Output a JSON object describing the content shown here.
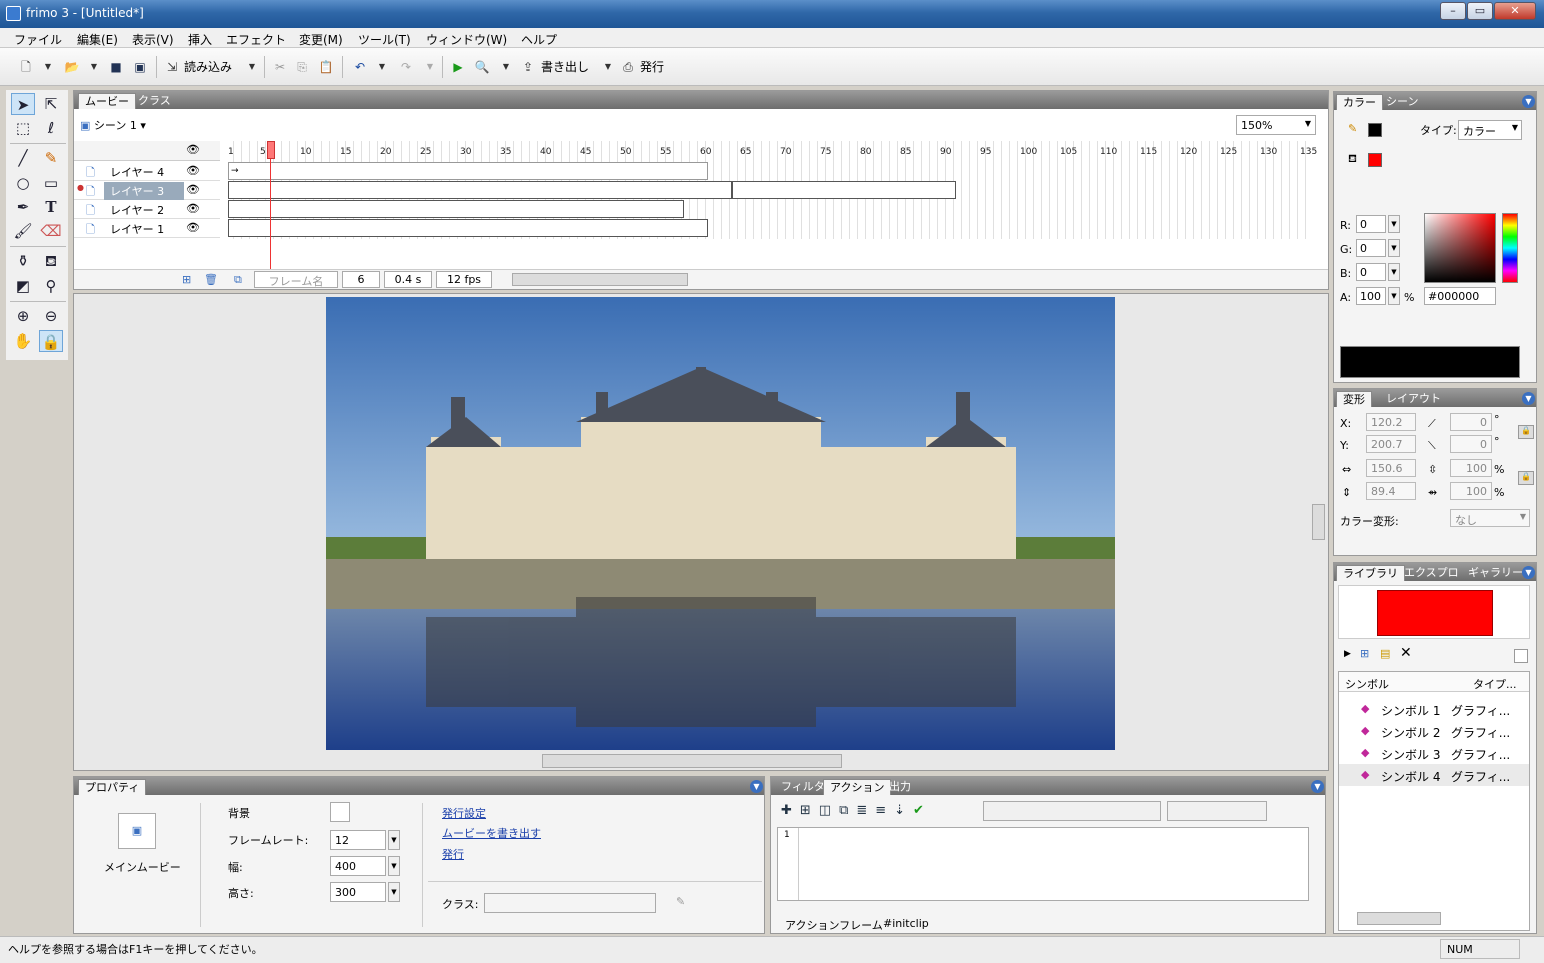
{
  "window": {
    "title": "frimo 3 - [Untitled*]"
  },
  "menu": [
    "ファイル",
    "編集(E)",
    "表示(V)",
    "挿入",
    "エフェクト",
    "変更(M)",
    "ツール(T)",
    "ウィンドウ(W)",
    "ヘルプ"
  ],
  "toolbar": {
    "import_label": "読み込み",
    "export_label": "書き出し",
    "publish_label": "発行"
  },
  "timeline": {
    "tabs": [
      "ムービー",
      "クラス"
    ],
    "scene_label": "シーン 1",
    "zoom": "150%",
    "ruler": [
      "1",
      "5",
      "10",
      "15",
      "20",
      "25",
      "30",
      "35",
      "40",
      "45",
      "50",
      "55",
      "60",
      "65",
      "70",
      "75",
      "80",
      "85",
      "90",
      "95",
      "100",
      "105",
      "110",
      "115",
      "120",
      "125",
      "130",
      "135"
    ],
    "layers": [
      "レイヤー 4",
      "レイヤー 3",
      "レイヤー 2",
      "レイヤー 1"
    ],
    "frame_name_placeholder": "フレーム名",
    "current_frame": "6",
    "time": "0.4 s",
    "fps": "12 fps"
  },
  "properties": {
    "tab": "プロパティ",
    "main_movie": "メインムービー",
    "bg_label": "背景",
    "framerate_label": "フレームレート:",
    "framerate": "12",
    "width_label": "幅:",
    "width": "400",
    "height_label": "高さ:",
    "height": "300",
    "links": [
      "発行設定",
      "ムービーを書き出す",
      "発行"
    ],
    "class_label": "クラス:"
  },
  "actions": {
    "tabs": [
      "フィルタ",
      "アクション",
      "出力"
    ],
    "line": "1",
    "bottom_tabs": [
      "アクションフレーム",
      "#initclip"
    ]
  },
  "color_panel": {
    "tabs": [
      "カラー",
      "シーン"
    ],
    "type_label": "タイプ:",
    "type_value": "カラー",
    "r": "0",
    "g": "0",
    "b": "0",
    "a": "100",
    "hex": "#000000",
    "labels": {
      "r": "R:",
      "g": "G:",
      "b": "B:",
      "a": "A:",
      "pct": "%"
    }
  },
  "transform_panel": {
    "tabs": [
      "変形",
      "レイアウト"
    ],
    "x_label": "X:",
    "x": "120.2",
    "y_label": "Y:",
    "y": "200.7",
    "w": "150.6",
    "h": "89.4",
    "skew1": "0",
    "skew2": "0",
    "scale1": "100",
    "scale2": "100",
    "deg": "°",
    "pct": "%",
    "color_transform_label": "カラー変形:",
    "color_transform_value": "なし"
  },
  "library_panel": {
    "tabs": [
      "ライブラリ",
      "エクスプロ",
      "ギャラリー"
    ],
    "col_symbol": "シンボル",
    "col_type": "タイプ...",
    "items": [
      {
        "name": "シンボル 1",
        "type": "グラフィ..."
      },
      {
        "name": "シンボル 2",
        "type": "グラフィ..."
      },
      {
        "name": "シンボル 3",
        "type": "グラフィ..."
      },
      {
        "name": "シンボル 4",
        "type": "グラフィ..."
      }
    ]
  },
  "status": {
    "help": "ヘルプを参照する場合はF1キーを押してください。",
    "num": "NUM"
  }
}
